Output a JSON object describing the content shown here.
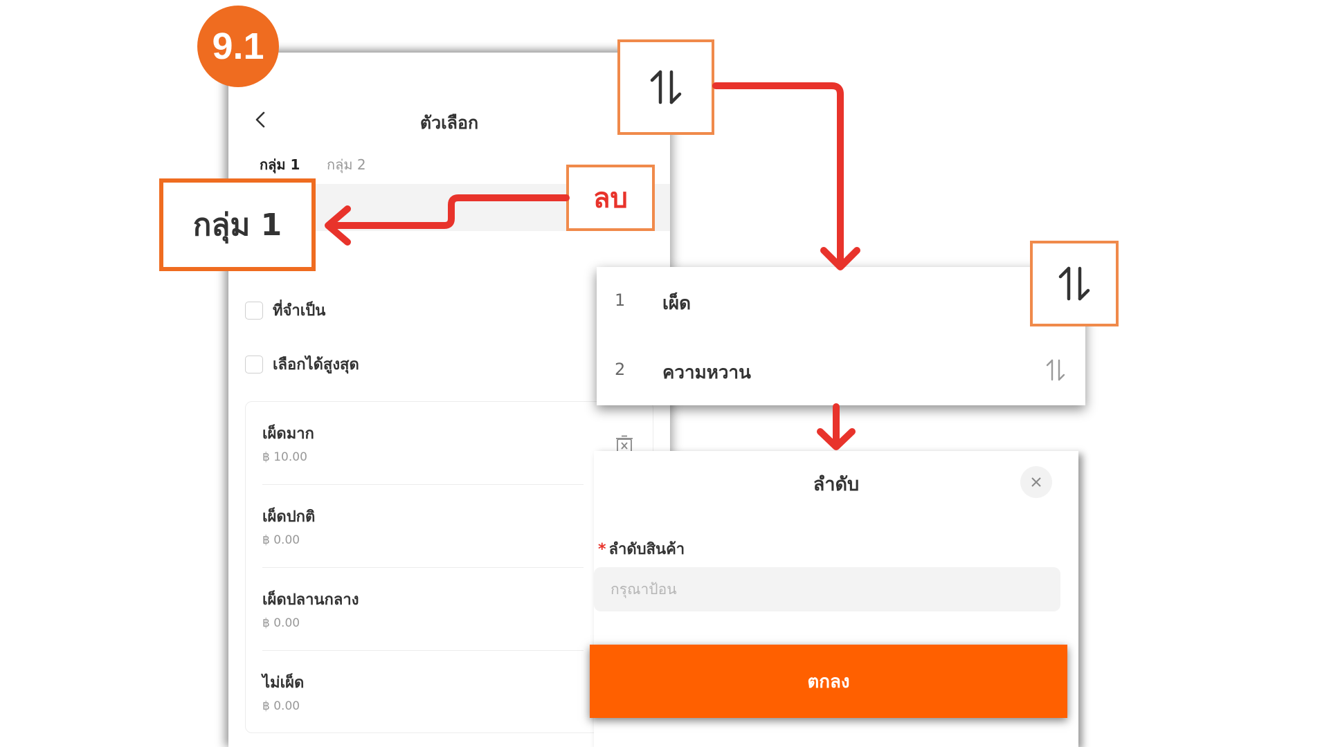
{
  "step_badge": "9.1",
  "screen": {
    "title": "ตัวเลือก",
    "tabs": [
      "กลุ่ม 1",
      "กลุ่ม 2"
    ],
    "checkboxes": {
      "required": "ที่จำเป็น",
      "max_select": "เลือกได้สูงสุด"
    },
    "items": [
      {
        "name": "เผ็ดมาก",
        "price": "฿ 10.00"
      },
      {
        "name": "เผ็ดปกติ",
        "price": "฿ 0.00"
      },
      {
        "name": "เผ็ดปลานกลาง",
        "price": "฿ 0.00"
      },
      {
        "name": "ไม่เผ็ด",
        "price": "฿ 0.00"
      }
    ]
  },
  "callouts": {
    "group_label": "กลุ่ม 1",
    "delete_label": "ลบ",
    "sort_icon": "sort-up-down-icon"
  },
  "sort_list": [
    {
      "index": "1",
      "name": "เผ็ด"
    },
    {
      "index": "2",
      "name": "ความหวาน"
    }
  ],
  "dialog": {
    "title": "ลำดับ",
    "required_mark": "*",
    "field_label": "ลำดับสินค้า",
    "field_placeholder": "กรุณาป้อน",
    "field_value": "",
    "confirm_label": "ตกลง"
  },
  "colors": {
    "badge": "#ef6c20",
    "callout_border": "#ef6c20",
    "arrow": "#e8332b",
    "confirm_button": "#ff6000",
    "delete_text": "#e8332b"
  }
}
